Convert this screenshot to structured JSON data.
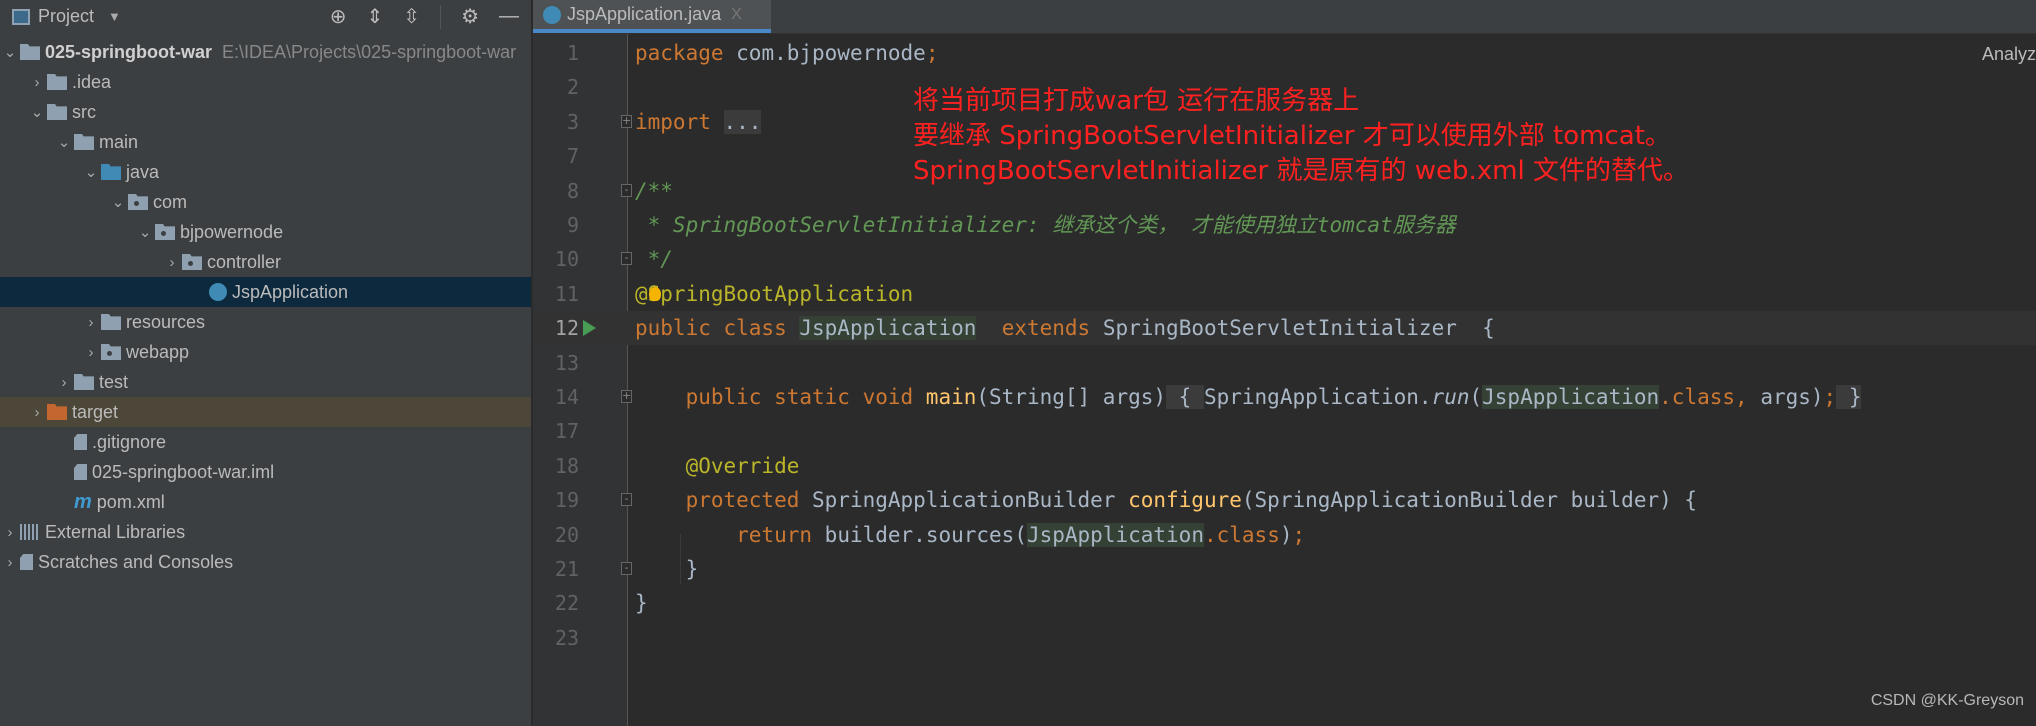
{
  "project_panel": {
    "title": "Project",
    "tools": [
      "locate-icon",
      "expand-all-icon",
      "collapse-all-icon",
      "gear-icon",
      "minimize-icon"
    ],
    "tree": [
      {
        "label": "025-springboot-war",
        "path": "E:\\IDEA\\Projects\\025-springboot-war",
        "level": 0,
        "chev": "open",
        "icon": "module",
        "root": true
      },
      {
        "label": ".idea",
        "level": 1,
        "chev": "closed",
        "icon": "folder"
      },
      {
        "label": "src",
        "level": 1,
        "chev": "open",
        "icon": "folder"
      },
      {
        "label": "main",
        "level": 2,
        "chev": "open",
        "icon": "folder"
      },
      {
        "label": "java",
        "level": 3,
        "chev": "open",
        "icon": "folder-blue"
      },
      {
        "label": "com",
        "level": 4,
        "chev": "open",
        "icon": "package"
      },
      {
        "label": "bjpowernode",
        "level": 5,
        "chev": "open",
        "icon": "package"
      },
      {
        "label": "controller",
        "level": 6,
        "chev": "closed",
        "icon": "package"
      },
      {
        "label": "JspApplication",
        "level": 7,
        "chev": "none",
        "icon": "spring-class",
        "selected": true
      },
      {
        "label": "resources",
        "level": 3,
        "chev": "closed",
        "icon": "folder"
      },
      {
        "label": "webapp",
        "level": 3,
        "chev": "closed",
        "icon": "package"
      },
      {
        "label": "test",
        "level": 2,
        "chev": "closed",
        "icon": "folder"
      },
      {
        "label": "target",
        "level": 1,
        "chev": "closed",
        "icon": "folder-orange",
        "excluded": true
      },
      {
        "label": ".gitignore",
        "level": 2,
        "chev": "none",
        "icon": "file"
      },
      {
        "label": "025-springboot-war.iml",
        "level": 2,
        "chev": "none",
        "icon": "file"
      },
      {
        "label": "pom.xml",
        "level": 2,
        "chev": "none",
        "icon": "maven"
      },
      {
        "label": "External Libraries",
        "level": 0,
        "chev": "closed",
        "icon": "libraries"
      },
      {
        "label": "Scratches and Consoles",
        "level": 0,
        "chev": "closed",
        "icon": "scratches"
      }
    ]
  },
  "editor": {
    "tab": {
      "label": "JspApplication.java",
      "close": "X"
    },
    "analyze_label": "Analyz",
    "current_line": 12,
    "lines": [
      {
        "n": "1",
        "tokens": [
          [
            "kw",
            "package "
          ],
          [
            "tx",
            "com.bjpowernode"
          ],
          [
            "kw",
            ";"
          ]
        ]
      },
      {
        "n": "2",
        "tokens": []
      },
      {
        "n": "3",
        "fold": "+",
        "tokens": [
          [
            "kw",
            "import "
          ],
          [
            "fb",
            "..."
          ]
        ]
      },
      {
        "n": "7",
        "tokens": []
      },
      {
        "n": "8",
        "fold": "-",
        "tokens": [
          [
            "doc",
            "/**"
          ]
        ]
      },
      {
        "n": "9",
        "tokens": [
          [
            "doc",
            " * SpringBootServletInitializer: 继承这个类， 才能使用独立tomcat服务器"
          ]
        ]
      },
      {
        "n": "10",
        "fold": "-",
        "tokens": [
          [
            "doc",
            " */"
          ]
        ]
      },
      {
        "n": "11",
        "bulb": true,
        "tokens": [
          [
            "an",
            "@SpringBootApplication"
          ]
        ]
      },
      {
        "n": "12",
        "run": true,
        "tokens": [
          [
            "kw",
            "public class "
          ],
          [
            "hl",
            "JspApplication"
          ],
          [
            "tx",
            "  "
          ],
          [
            "kw",
            "extends "
          ],
          [
            "tx",
            "SpringBootServletInitializer  {"
          ]
        ]
      },
      {
        "n": "13",
        "tokens": []
      },
      {
        "n": "14",
        "fold": "+",
        "tokens": [
          [
            "tx",
            "    "
          ],
          [
            "kw",
            "public static void "
          ],
          [
            "fn",
            "main"
          ],
          [
            "tx",
            "(String[] args)"
          ],
          [
            "fb",
            " { "
          ],
          [
            "tx",
            "SpringApplication."
          ],
          [
            "it",
            "run"
          ],
          [
            "tx",
            "("
          ],
          [
            "hl",
            "JspApplication"
          ],
          [
            "kw",
            ".class, "
          ],
          [
            "tx",
            "args)"
          ],
          [
            "kw",
            ";"
          ],
          [
            "fb",
            " }"
          ]
        ]
      },
      {
        "n": "17",
        "tokens": []
      },
      {
        "n": "18",
        "tokens": [
          [
            "tx",
            "    "
          ],
          [
            "an",
            "@Override"
          ]
        ]
      },
      {
        "n": "19",
        "fold": "-",
        "tokens": [
          [
            "tx",
            "    "
          ],
          [
            "kw",
            "protected "
          ],
          [
            "tx",
            "SpringApplicationBuilder "
          ],
          [
            "fn",
            "configure"
          ],
          [
            "tx",
            "(SpringApplicationBuilder builder) {"
          ]
        ]
      },
      {
        "n": "20",
        "tokens": [
          [
            "tx",
            "        "
          ],
          [
            "kw",
            "return "
          ],
          [
            "tx",
            "builder.sources("
          ],
          [
            "hl",
            "JspApplication"
          ],
          [
            "kw",
            ".class"
          ],
          [
            "tx",
            ")"
          ],
          [
            "kw",
            ";"
          ]
        ]
      },
      {
        "n": "21",
        "fold": "-",
        "tokens": [
          [
            "tx",
            "    }"
          ]
        ]
      },
      {
        "n": "22",
        "tokens": [
          [
            "tx",
            "}"
          ]
        ]
      },
      {
        "n": "23",
        "tokens": []
      }
    ]
  },
  "annotation_note": {
    "lines": [
      "将当前项目打成war包 运行在服务器上",
      "要继承 SpringBootServletInitializer 才可以使用外部 tomcat。",
      "SpringBootServletInitializer 就是原有的 web.xml 文件的替代。"
    ],
    "color": "#ff2020"
  },
  "watermark": "CSDN @KK-Greyson",
  "colors": {
    "keyword": "#cc7832",
    "text": "#a9b7c6",
    "annotation": "#bbb529",
    "doc_comment": "#629755",
    "method": "#ffc66d",
    "editor_bg": "#2b2b2b",
    "panel_bg": "#3c3f41",
    "selection": "#0d293e"
  }
}
